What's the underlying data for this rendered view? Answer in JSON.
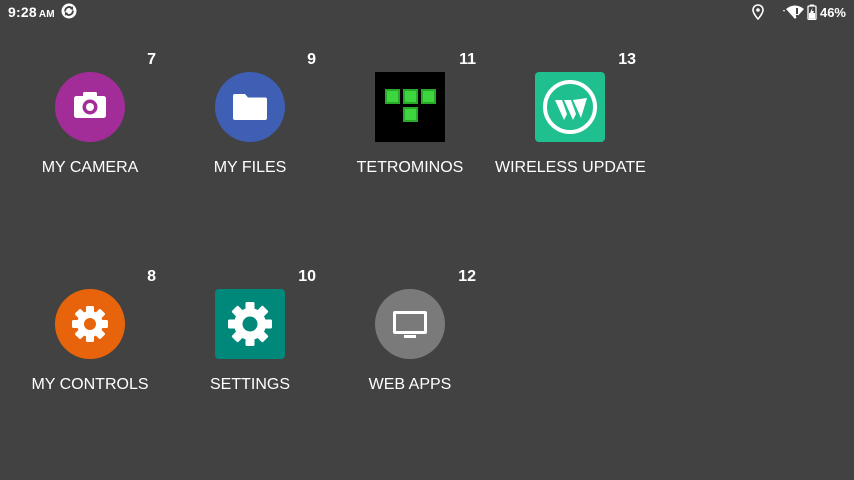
{
  "status_bar": {
    "time": "9:28",
    "ampm": "AM",
    "battery_percent": "46%",
    "icons": [
      "sync-icon",
      "location-icon",
      "wifi-icon",
      "battery-icon"
    ]
  },
  "apps": [
    {
      "id": "my-camera",
      "label": "MY CAMERA",
      "number": "7",
      "icon": "camera-icon",
      "color": "#a32d98"
    },
    {
      "id": "my-files",
      "label": "MY FILES",
      "number": "9",
      "icon": "folder-icon",
      "color": "#3f5fb5"
    },
    {
      "id": "tetrominos",
      "label": "TETROMINOS",
      "number": "11",
      "icon": "tetromino-icon",
      "color": "#000000"
    },
    {
      "id": "wireless-update",
      "label": "WIRELESS UPDATE",
      "number": "13",
      "icon": "wireless-update-icon",
      "color": "#1fbf8f"
    },
    {
      "id": "my-controls",
      "label": "MY CONTROLS",
      "number": "8",
      "icon": "gear-icon",
      "color": "#e8640c"
    },
    {
      "id": "settings",
      "label": "SETTINGS",
      "number": "10",
      "icon": "settings-gear-icon",
      "color": "#00897b"
    },
    {
      "id": "web-apps",
      "label": "WEB APPS",
      "number": "12",
      "icon": "monitor-icon",
      "color": "#7a7a7a"
    }
  ]
}
